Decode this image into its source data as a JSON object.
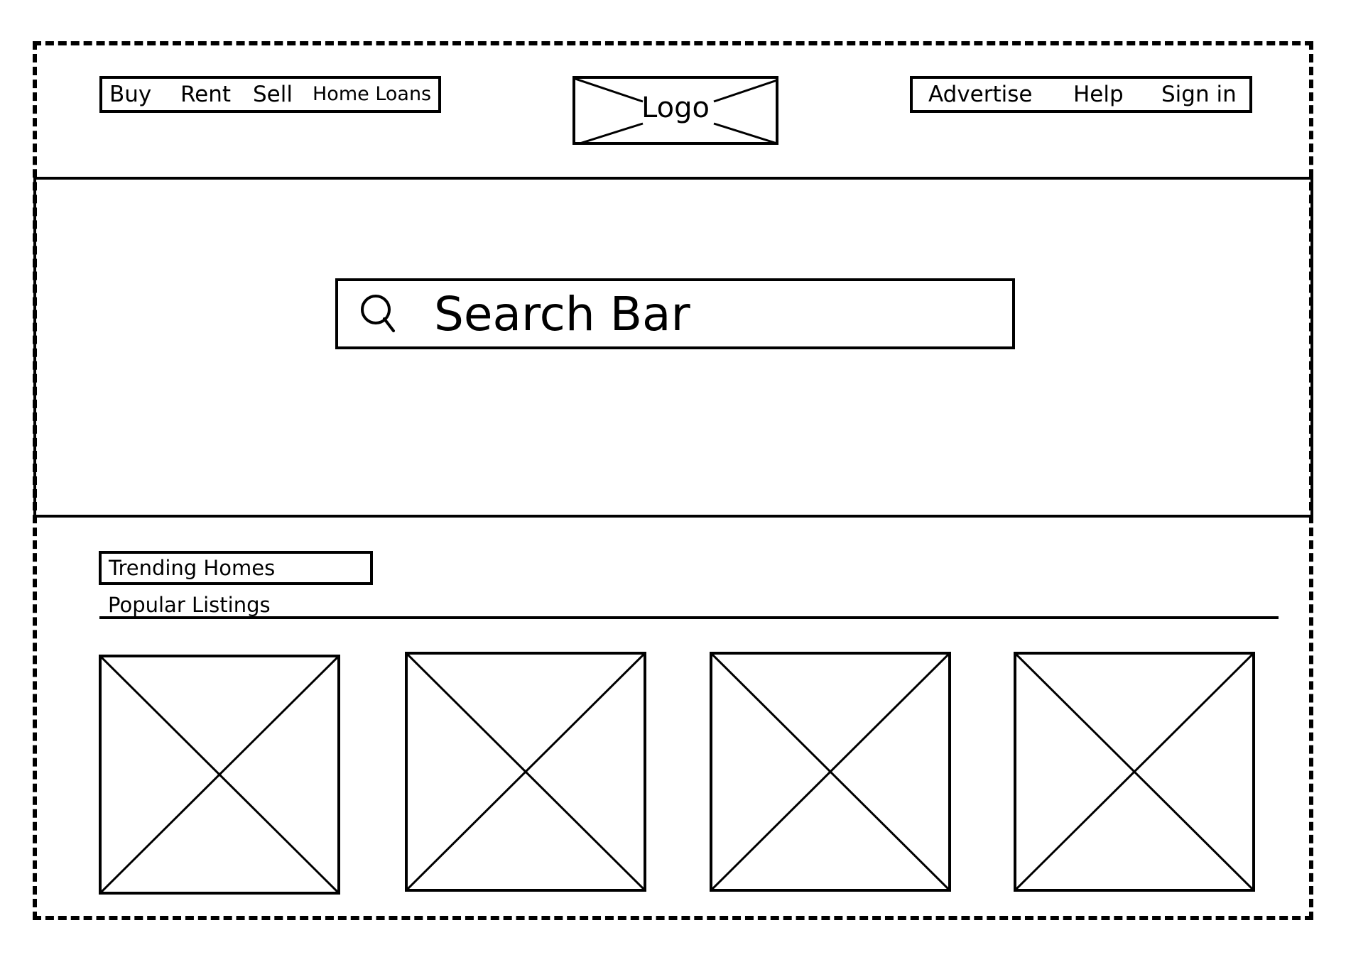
{
  "header": {
    "nav_left": [
      "Buy",
      "Rent",
      "Sell",
      "Home Loans"
    ],
    "logo_label": "Logo",
    "nav_right": [
      "Advertise",
      "Help",
      "Sign in"
    ]
  },
  "hero": {
    "search": {
      "label": "Search Bar",
      "icon": "search-icon"
    }
  },
  "section": {
    "title": "Trending Homes",
    "subtitle": "Popular Listings"
  },
  "listings": [
    {
      "image": "image-placeholder"
    },
    {
      "image": "image-placeholder"
    },
    {
      "image": "image-placeholder"
    },
    {
      "image": "image-placeholder"
    }
  ]
}
